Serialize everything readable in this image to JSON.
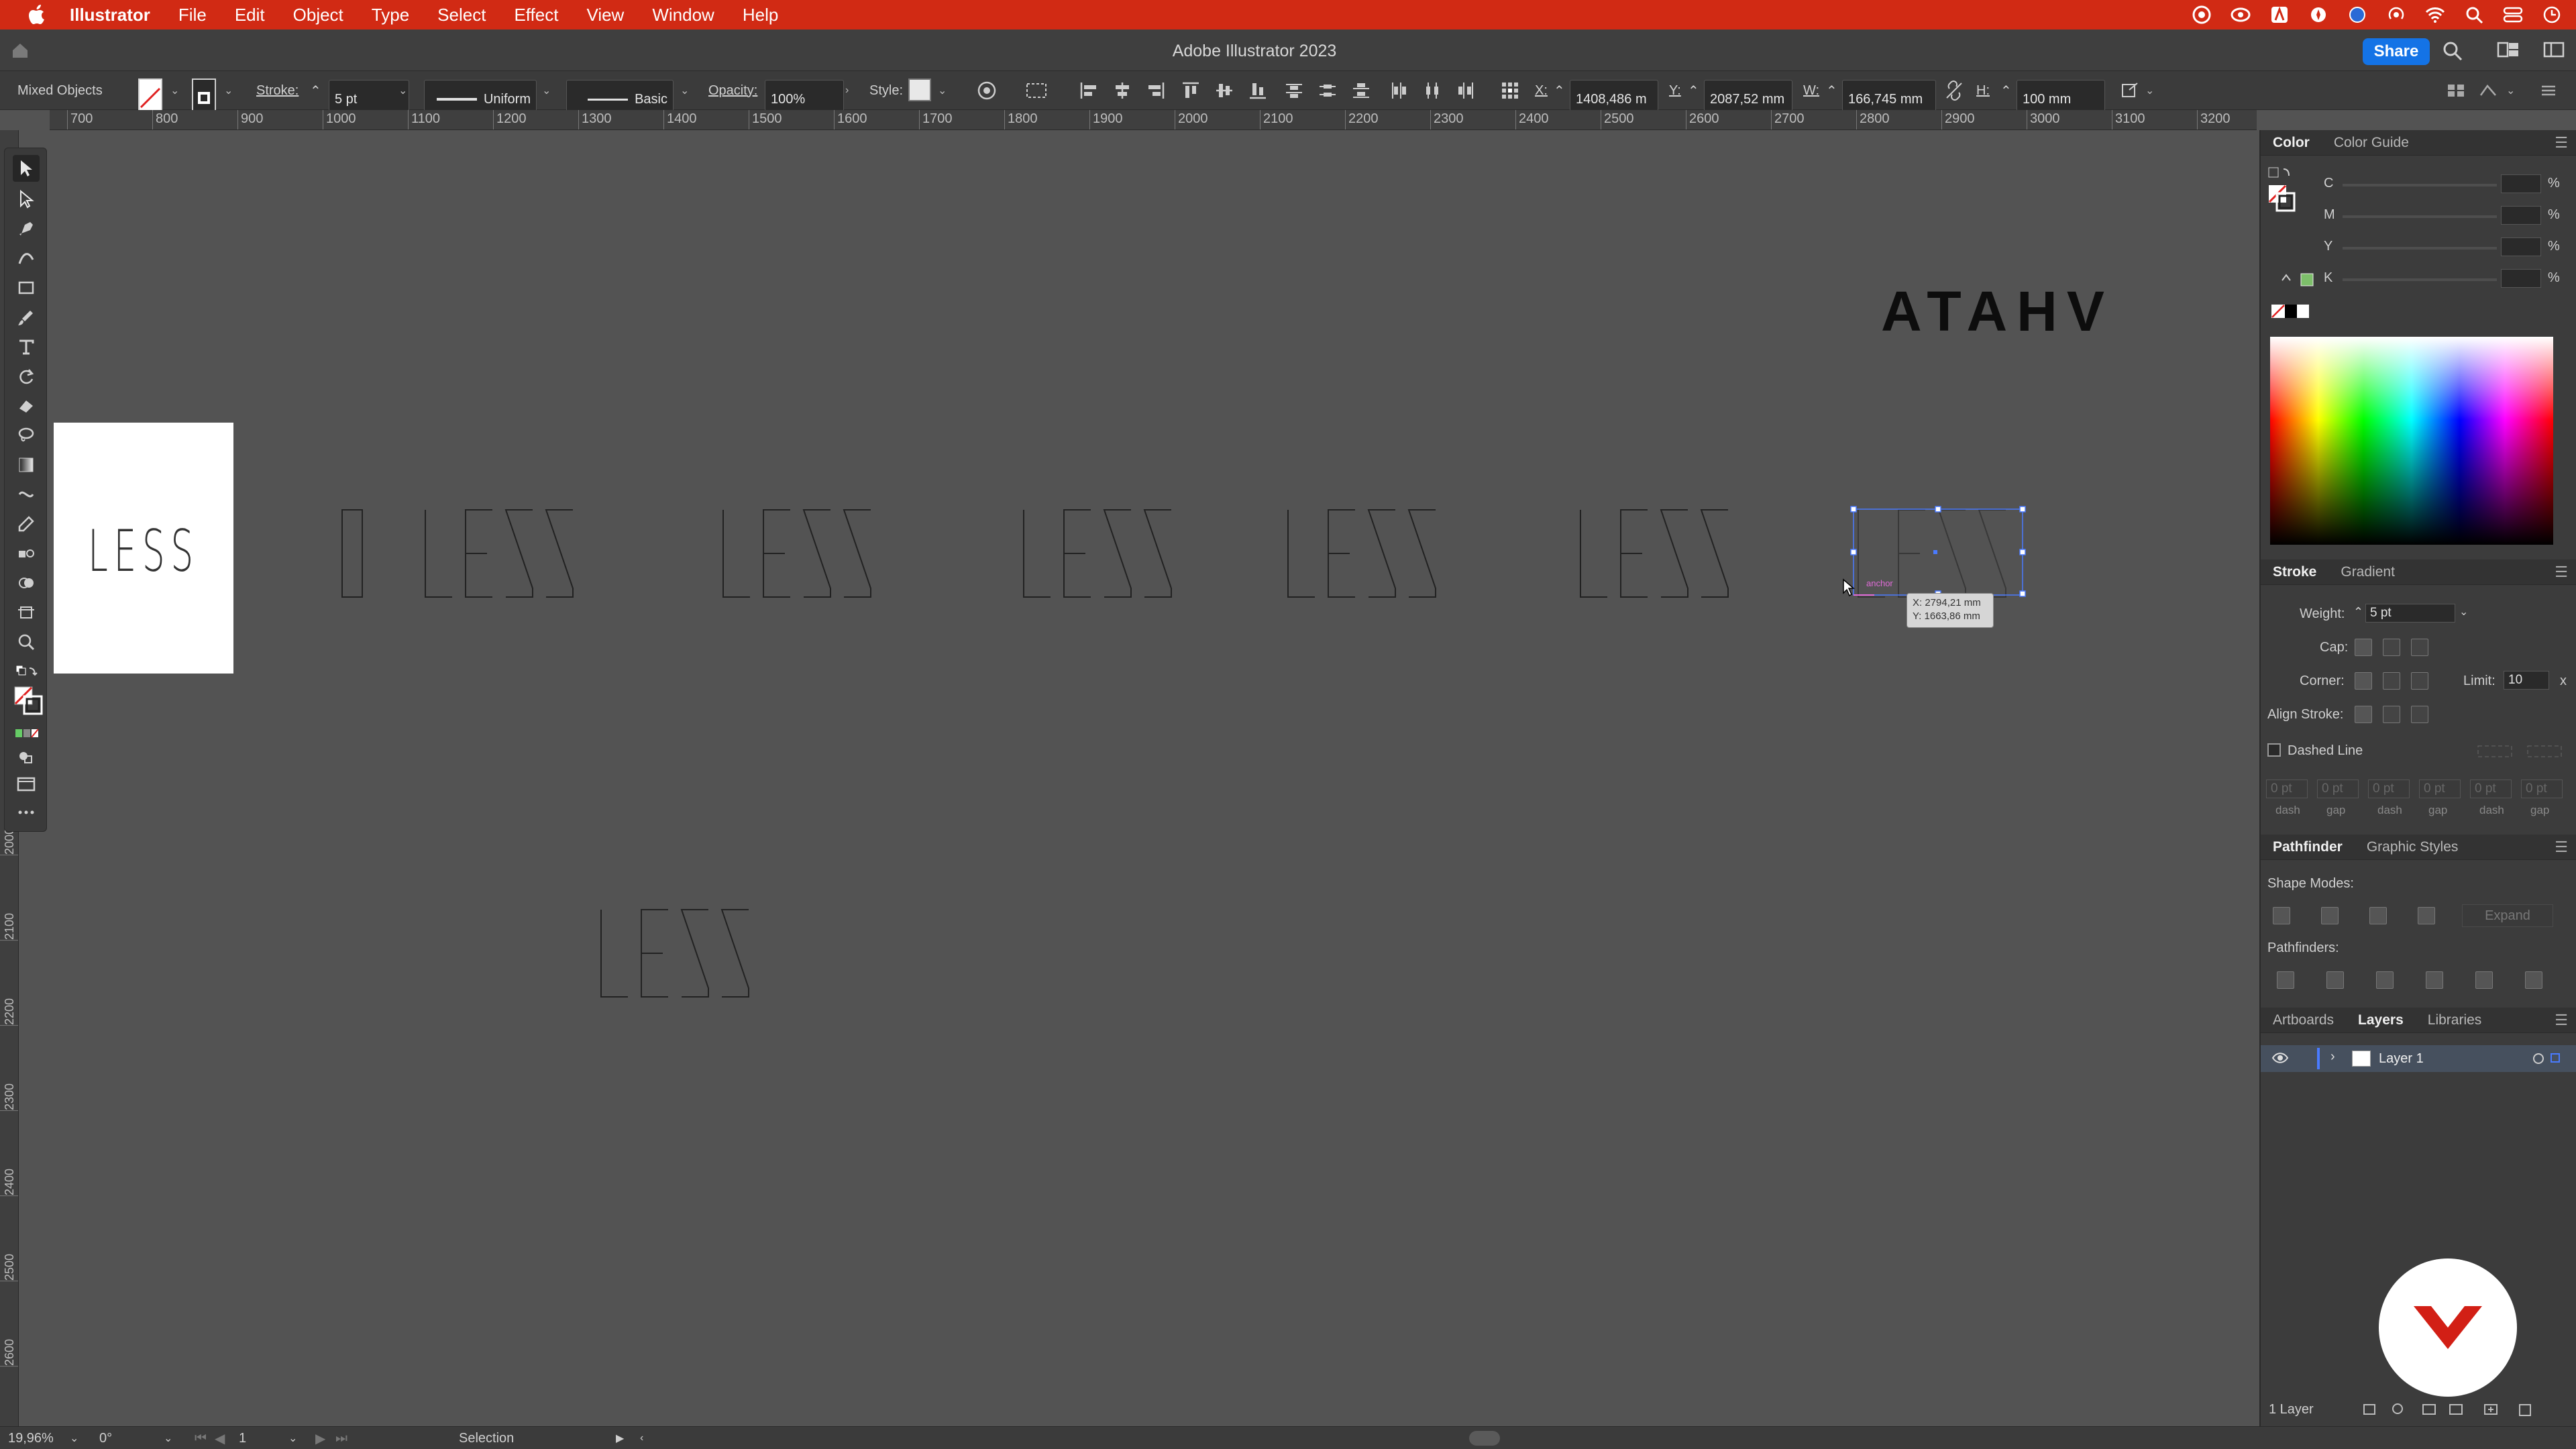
{
  "menubar": {
    "app_name": "Illustrator",
    "items": [
      "File",
      "Edit",
      "Object",
      "Type",
      "Select",
      "Effect",
      "View",
      "Window",
      "Help"
    ]
  },
  "titlebar": {
    "title": "Adobe Illustrator 2023",
    "share_label": "Share"
  },
  "controlbar": {
    "selection_label": "Mixed Objects",
    "stroke_label": "Stroke:",
    "stroke_value": "5 pt",
    "profile_value": "Uniform",
    "brush_value": "Basic",
    "opacity_label": "Opacity:",
    "opacity_value": "100%",
    "style_label": "Style:",
    "x_label": "X:",
    "x_value": "1408,486 m",
    "y_label": "Y:",
    "y_value": "2087,52 mm",
    "w_label": "W:",
    "w_value": "166,745 mm",
    "h_label": "H:",
    "h_value": "100 mm"
  },
  "ruler": {
    "h_ticks": [
      "700",
      "800",
      "900",
      "1000",
      "1100",
      "1200",
      "1300",
      "1400",
      "1500",
      "1600",
      "1700",
      "1800",
      "1900",
      "2000",
      "2100",
      "2200",
      "2300",
      "2400",
      "2500",
      "2600",
      "2700",
      "2800",
      "2900",
      "3000",
      "3100",
      "3200"
    ],
    "v_ticks": [
      "2000",
      "2100",
      "2200",
      "2300",
      "2400",
      "2500",
      "2600"
    ]
  },
  "canvas": {
    "artboard_text": "LESS",
    "outline_word": "LESS",
    "leading_glyph": "O",
    "atahv_text": "ATAHV",
    "anchor_label": "anchor",
    "tooltip_x": "X: 2794,21 mm",
    "tooltip_y": "Y: 1663,86 mm"
  },
  "panels": {
    "color_tabs": [
      "Color",
      "Color Guide"
    ],
    "cmyk_labels": [
      "C",
      "M",
      "Y",
      "K"
    ],
    "percent": "%",
    "stroke_tabs": [
      "Stroke",
      "Gradient"
    ],
    "weight_label": "Weight:",
    "weight_value": "5 pt",
    "cap_label": "Cap:",
    "corner_label": "Corner:",
    "limit_label": "Limit:",
    "limit_value": "10",
    "limit_suffix": "x",
    "align_stroke_label": "Align Stroke:",
    "dashed_line_label": "Dashed Line",
    "dash_labels": [
      "dash",
      "gap",
      "dash",
      "gap",
      "dash",
      "gap"
    ],
    "dash_values": [
      "0 pt",
      "0 pt",
      "0 pt",
      "0 pt",
      "0 pt",
      "0 pt"
    ],
    "pathfinder_tabs": [
      "Pathfinder",
      "Graphic Styles"
    ],
    "shape_modes_label": "Shape Modes:",
    "expand_label": "Expand",
    "pathfinders_label": "Pathfinders:",
    "layer_tabs": [
      "Artboards",
      "Layers",
      "Libraries"
    ],
    "layer_name": "Layer 1",
    "layer_count": "1 Layer"
  },
  "statusbar": {
    "zoom": "19,96%",
    "rotation": "0°",
    "artboard_number": "1",
    "tool_name": "Selection"
  },
  "colors": {
    "menubar": "#d12a14",
    "share": "#1473e6",
    "selection": "#4a7bff",
    "badge_mark": "#d21f15"
  }
}
